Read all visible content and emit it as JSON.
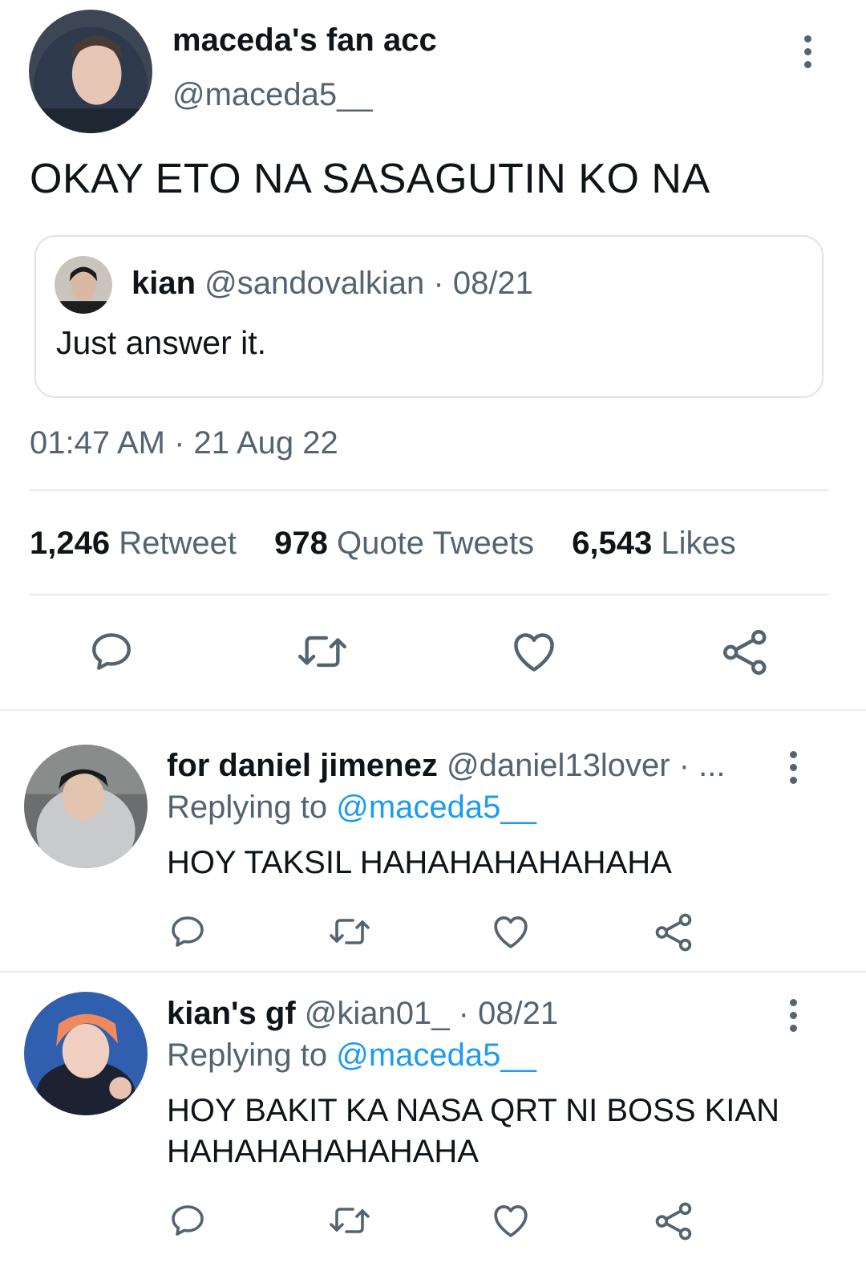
{
  "main_tweet": {
    "author_name": "maceda's fan acc",
    "author_handle": "@maceda5__",
    "text": "OKAY ETO NA SASAGUTIN KO NA",
    "quoted": {
      "name": "kian",
      "meta": "@sandovalkian · 08/21",
      "text": "Just answer it."
    },
    "timestamp": "01:47 AM · 21 Aug 22",
    "stats": [
      {
        "num": "1,246",
        "label": "Retweet"
      },
      {
        "num": "978",
        "label": "Quote Tweets"
      },
      {
        "num": "6,543",
        "label": "Likes"
      }
    ],
    "icons": [
      "reply-icon",
      "retweet-icon",
      "like-icon",
      "share-icon"
    ]
  },
  "replies": [
    {
      "name": "for daniel jimenez",
      "meta": "@daniel13lover · ...",
      "replying_prefix": "Replying to ",
      "replying_to": "@maceda5__",
      "text": "HOY TAKSIL HAHAHAHAHAHAHA"
    },
    {
      "name": "kian's gf",
      "meta": "@kian01_ · 08/21",
      "replying_prefix": "Replying to ",
      "replying_to": "@maceda5__",
      "text": "HOY BAKIT KA NASA QRT NI BOSS KIAN HAHAHAHAHAHAHA"
    }
  ],
  "colors": {
    "text_primary": "#0f1419",
    "text_secondary": "#536471",
    "link": "#1d9bf0",
    "divider": "#e7ebee"
  }
}
